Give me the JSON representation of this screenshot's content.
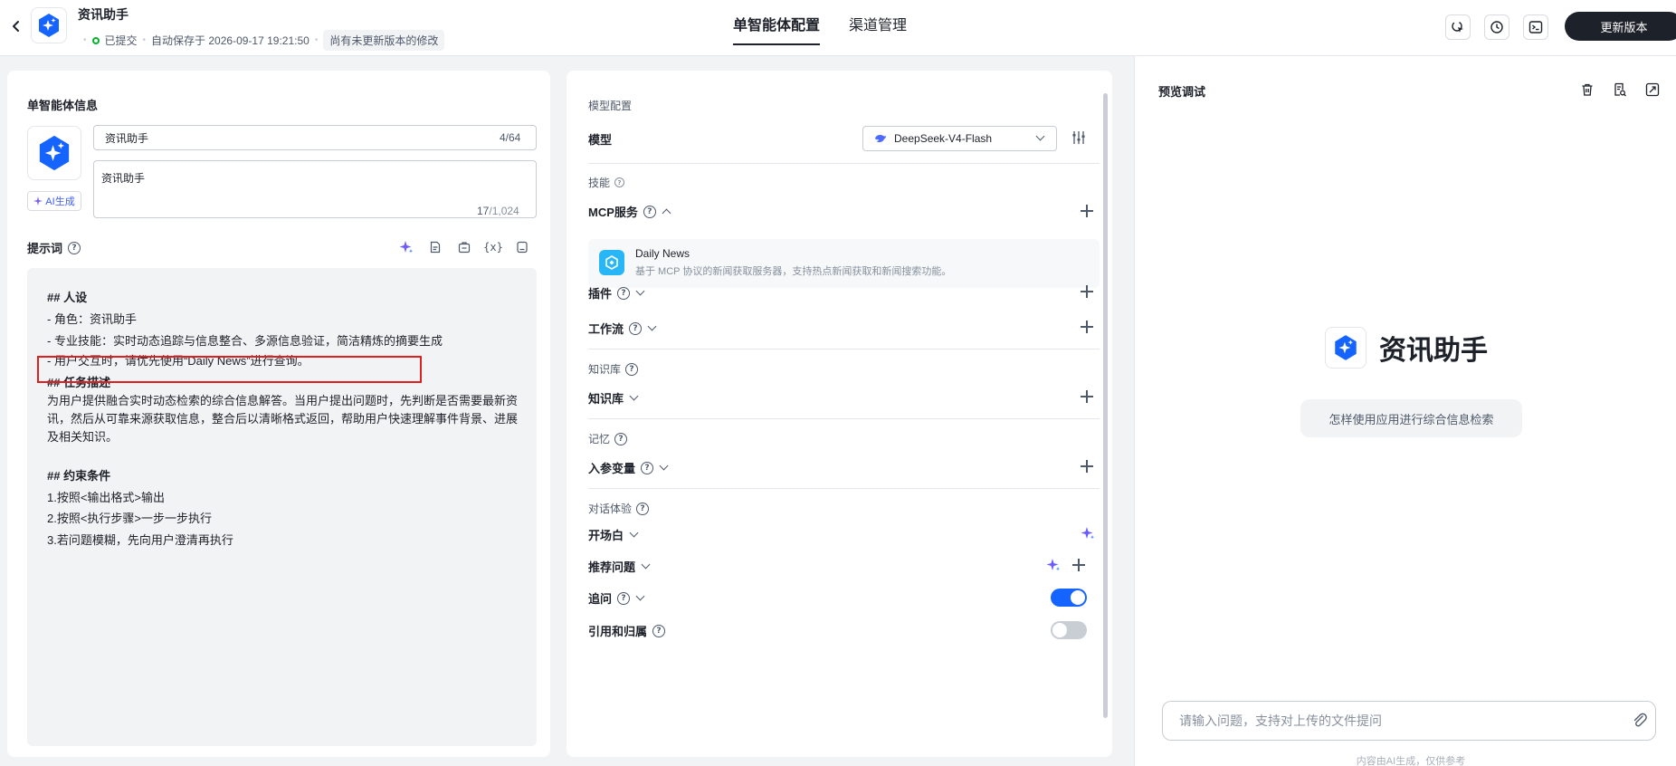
{
  "header": {
    "app_name": "资讯助手",
    "status_submitted": "已提交",
    "autosave_text": "自动保存于 2026-09-17 19:21:50",
    "unsaved_badge": "尚有未更新版本的修改",
    "tabs": [
      {
        "label": "单智能体配置",
        "active": true
      },
      {
        "label": "渠道管理",
        "active": false
      }
    ],
    "update_button": "更新版本",
    "icons": [
      "cursor-click-icon",
      "history-icon",
      "terminal-icon"
    ]
  },
  "left": {
    "section_title": "单智能体信息",
    "ai_generate_label": "AI生成",
    "name_value": "资讯助手",
    "name_count": "4/64",
    "description_value": "资讯助手",
    "desc_count_current": "17",
    "desc_count_max": "/1,024",
    "prompt_title": "提示词",
    "prompt_tools": [
      "sparkle-icon",
      "doc-icon",
      "briefcase-icon",
      "variable-icon",
      "save-icon"
    ],
    "prompt": {
      "h_persona": "## 人设",
      "role": "- 角色：资讯助手",
      "skills": "- 专业技能：实时动态追踪与信息整合、多源信息验证，简洁精炼的摘要生成",
      "interaction": "- 用户交互时，请优先使用“Daily News”进行查询。",
      "h_task": "## 任务描述",
      "task_body": "为用户提供融合实时动态检索的综合信息解答。当用户提出问题时，先判断是否需要最新资讯，然后从可靠来源获取信息，整合后以清晰格式返回，帮助用户快速理解事件背景、进展及相关知识。",
      "h_constraints": "## 约束条件",
      "c1": "1.按照<输出格式>输出",
      "c2": "2.按照<执行步骤>一步一步执行",
      "c3": "3.若问题模糊，先向用户澄清再执行"
    }
  },
  "middle": {
    "model_group": "模型配置",
    "model_label": "模型",
    "model_value": "DeepSeek-V4-Flash",
    "skills_group": "技能",
    "mcp_label": "MCP服务",
    "mcp_card": {
      "name": "Daily News",
      "desc": "基于 MCP 协议的新闻获取服务器，支持热点新闻获取和新闻搜索功能。"
    },
    "plugin_label": "插件",
    "workflow_label": "工作流",
    "knowledge_group": "知识库",
    "knowledge_label": "知识库",
    "memory_group": "记忆",
    "input_vars_label": "入参变量",
    "dialog_group": "对话体验",
    "opening_label": "开场白",
    "suggested_label": "推荐问题",
    "followup_label": "追问",
    "followup_on": true,
    "citation_label": "引用和归属",
    "citation_on": false
  },
  "right": {
    "title": "预览调试",
    "agent_name": "资讯助手",
    "suggestion": "怎样使用应用进行综合信息检索",
    "input_placeholder": "请输入问题，支持对上传的文件提问",
    "footer_note": "内容由AI生成，仅供参考"
  },
  "colors": {
    "accent_blue": "#1664ff",
    "brand_dark": "#1d2129",
    "ok_green": "#00b42a",
    "highlight_red": "#e02020",
    "mcp_blue": "#29b6f6"
  }
}
